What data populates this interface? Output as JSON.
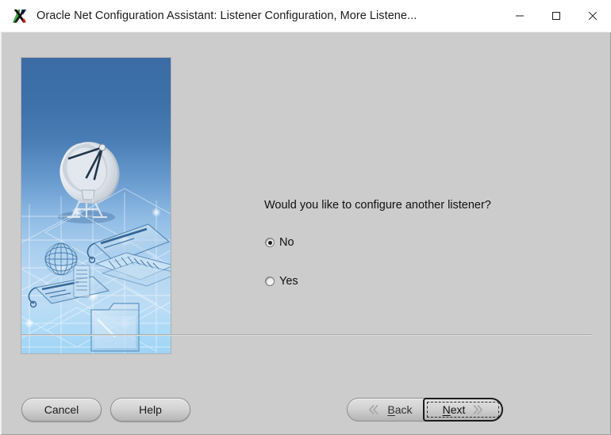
{
  "window": {
    "title": "Oracle Net Configuration Assistant: Listener Configuration, More Listene...",
    "app_icon": "x-logo-icon",
    "controls": {
      "minimize": "minimize-icon",
      "maximize": "maximize-icon",
      "close": "close-icon"
    }
  },
  "splash": {
    "alt": "satellite-dish-network-illustration"
  },
  "main": {
    "question": "Would you like to configure another listener?",
    "options": [
      {
        "label": "No",
        "selected": true
      },
      {
        "label": "Yes",
        "selected": false
      }
    ]
  },
  "buttons": {
    "cancel": "Cancel",
    "help": "Help",
    "back": {
      "prefix": "B",
      "rest": "ack",
      "icon": "chevron-double-left-icon"
    },
    "next": {
      "prefix": "N",
      "rest": "ext",
      "icon": "chevron-double-right-icon",
      "focused": true
    }
  },
  "colors": {
    "dialog_bg": "#cccccc",
    "titlebar_bg": "#ffffff",
    "splash_top": "#3b6ca5",
    "splash_bottom": "#9ed3f6",
    "text": "#101010",
    "button_border": "#8e8e8e",
    "focus_border": "#1c1c1c"
  }
}
